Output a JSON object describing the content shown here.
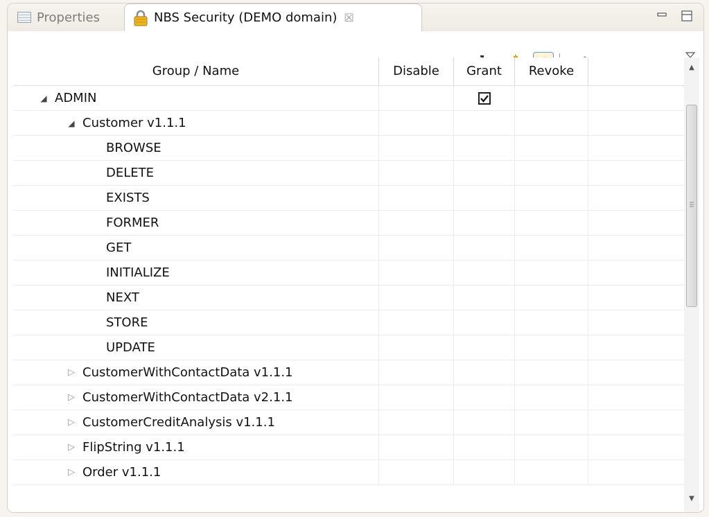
{
  "tabs": {
    "inactive_label": "Properties",
    "active_label": "NBS Security (DEMO domain)",
    "close_glyph": "☒"
  },
  "window": {
    "minimize_icon": "minimize-icon",
    "maximize_icon": "maximize-icon"
  },
  "toolbar": {
    "buttons": [
      "export-icon",
      "new-folder-icon",
      "link-editor-icon",
      "home-icon",
      "back-icon",
      "forward-icon",
      "view-menu-icon"
    ]
  },
  "table": {
    "columns": {
      "name": "Group / Name",
      "disable": "Disable",
      "grant": "Grant",
      "revoke": "Revoke"
    },
    "rows": [
      {
        "label": "ADMIN",
        "level": 0,
        "twisty": "expanded",
        "grant": true
      },
      {
        "label": "Customer v1.1.1",
        "level": 1,
        "twisty": "expanded",
        "grant": false
      },
      {
        "label": "BROWSE",
        "level": 2,
        "twisty": "none",
        "grant": false
      },
      {
        "label": "DELETE",
        "level": 2,
        "twisty": "none",
        "grant": false
      },
      {
        "label": "EXISTS",
        "level": 2,
        "twisty": "none",
        "grant": false
      },
      {
        "label": "FORMER",
        "level": 2,
        "twisty": "none",
        "grant": false
      },
      {
        "label": "GET",
        "level": 2,
        "twisty": "none",
        "grant": false
      },
      {
        "label": "INITIALIZE",
        "level": 2,
        "twisty": "none",
        "grant": false
      },
      {
        "label": "NEXT",
        "level": 2,
        "twisty": "none",
        "grant": false
      },
      {
        "label": "STORE",
        "level": 2,
        "twisty": "none",
        "grant": false
      },
      {
        "label": "UPDATE",
        "level": 2,
        "twisty": "none",
        "grant": false
      },
      {
        "label": "CustomerWithContactData v1.1.1",
        "level": 1,
        "twisty": "collapsed",
        "grant": false
      },
      {
        "label": "CustomerWithContactData v2.1.1",
        "level": 1,
        "twisty": "collapsed",
        "grant": false
      },
      {
        "label": "CustomerCreditAnalysis v1.1.1",
        "level": 1,
        "twisty": "collapsed",
        "grant": false
      },
      {
        "label": "FlipString v1.1.1",
        "level": 1,
        "twisty": "collapsed",
        "grant": false
      },
      {
        "label": "Order v1.1.1",
        "level": 1,
        "twisty": "collapsed",
        "grant": false
      }
    ]
  },
  "colors": {
    "accent_pressed_border": "#6f95c8",
    "forward_arrow": "#f2b51c",
    "lock_body": "#e9b526"
  }
}
